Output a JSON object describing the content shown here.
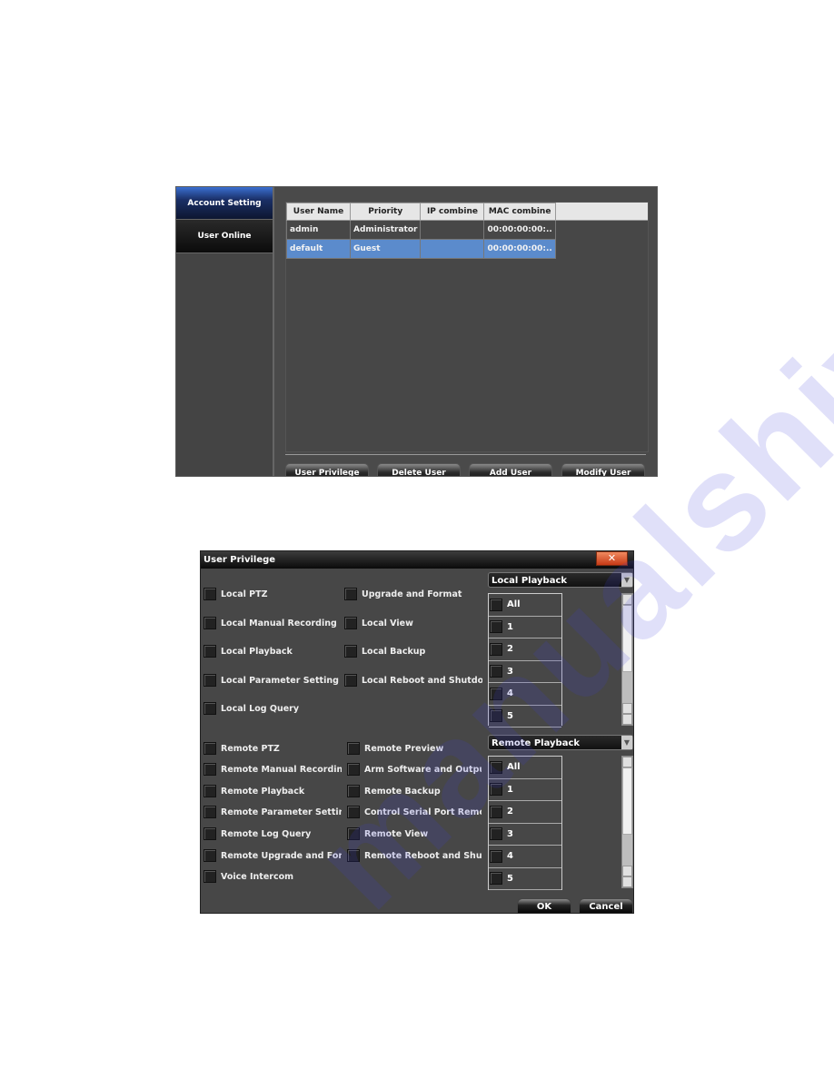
{
  "account": {
    "sidebar": [
      {
        "label": "Account Setting",
        "active": true
      },
      {
        "label": "User Online",
        "active": false
      }
    ],
    "table": {
      "columns": [
        "User Name",
        "Priority",
        "IP combine",
        "MAC combine"
      ],
      "rows": [
        {
          "user": "admin",
          "priority": "Administrator",
          "ip": "",
          "mac": "00:00:00:00:..",
          "selected": false
        },
        {
          "user": "default",
          "priority": "Guest",
          "ip": "",
          "mac": "00:00:00:00:..",
          "selected": true
        }
      ]
    },
    "buttons": {
      "user_privilege": "User Privilege",
      "delete_user": "Delete User",
      "add_user": "Add User",
      "modify_user": "Modify User"
    }
  },
  "dialog": {
    "title": "User Privilege",
    "close": "✕",
    "local_left": [
      "Local PTZ",
      "Local Manual Recording",
      "Local Playback",
      "Local Parameter Setting",
      "Local Log Query"
    ],
    "local_right": [
      "Upgrade and Format",
      "Local View",
      "Local Backup",
      "Local Reboot and Shutdov"
    ],
    "remote_left": [
      "Remote PTZ",
      "Remote Manual Recordin",
      "Remote Playback",
      "Remote Parameter Setting",
      "Remote Log Query",
      "Remote Upgrade  and For",
      "Voice Intercom"
    ],
    "remote_right": [
      "Remote Preview",
      "Arm Software and Output",
      "Remote Backup",
      "Control Serial Port Remot",
      "Remote View",
      "Remote Reboot and Shutc"
    ],
    "local_select": "Local Playback",
    "remote_select": "Remote Playback",
    "channels": [
      "All",
      "1",
      "2",
      "3",
      "4",
      "5"
    ],
    "ok": "OK",
    "cancel": "Cancel"
  },
  "watermark": "manualshive.com"
}
